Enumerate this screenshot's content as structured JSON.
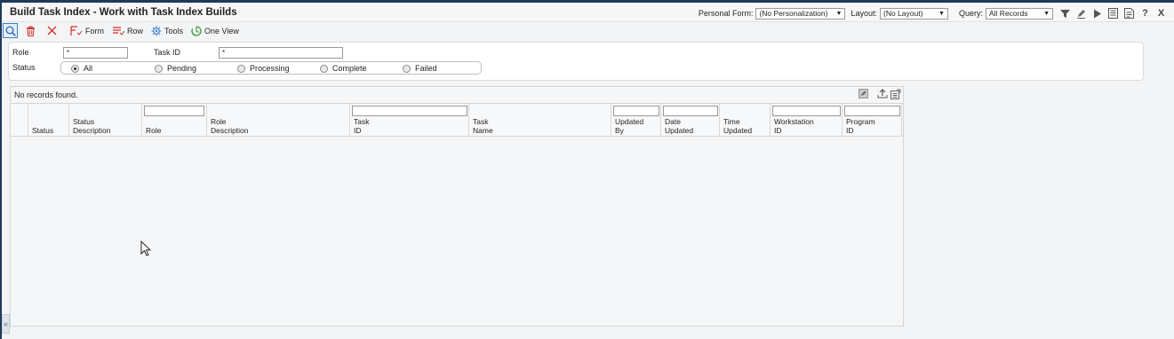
{
  "window": {
    "title": "Build Task Index - Work with Task Index Builds"
  },
  "header_controls": {
    "personal_form_label": "Personal Form:",
    "personal_form_value": "(No Personalization)",
    "layout_label": "Layout:",
    "layout_value": "(No Layout)",
    "query_label": "Query:",
    "query_value": "All Records",
    "icons": [
      "filter-icon",
      "edit-query-icon",
      "run-icon",
      "list-icon",
      "notes-icon",
      "help-icon",
      "close-icon"
    ],
    "help_glyph": "?",
    "close_glyph": "X"
  },
  "toolbar": {
    "find_icon": "search-icon",
    "delete_icon": "trash-icon",
    "cancel_icon": "x-icon",
    "form_label": "Form",
    "row_label": "Row",
    "tools_label": "Tools",
    "oneview_label": "One View"
  },
  "filters": {
    "role_label": "Role",
    "role_value": "*",
    "task_id_label": "Task ID",
    "task_id_value": "*",
    "status_label": "Status",
    "status_options": [
      "All",
      "Pending",
      "Processing",
      "Complete",
      "Failed"
    ],
    "status_selected": "All"
  },
  "grid": {
    "status_text": "No records found.",
    "columns": [
      "",
      "Status",
      "Status\nDescription",
      "Role",
      "Role\nDescription",
      "Task\nID",
      "Task\nName",
      "Updated\nBy",
      "Date\nUpdated",
      "Time\nUpdated",
      "Workstation\nID",
      "Program\nID"
    ],
    "rows": []
  },
  "colors": {
    "frame": "#1d3a5a",
    "accent_red": "#d0312d",
    "accent_blue": "#3b7fc4",
    "accent_green": "#3a9a3a"
  }
}
